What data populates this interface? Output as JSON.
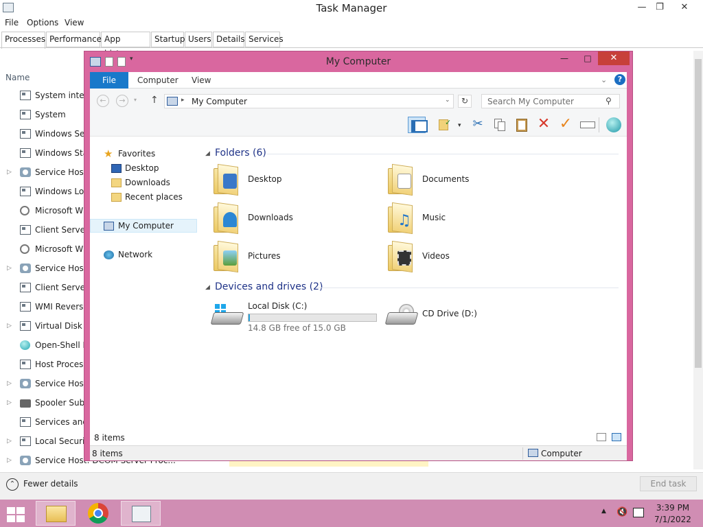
{
  "task_manager": {
    "title": "Task Manager",
    "menu": [
      "File",
      "Options",
      "View"
    ],
    "tabs": [
      "Processes",
      "Performance",
      "App history",
      "Startup",
      "Users",
      "Details",
      "Services"
    ],
    "active_tab": "Processes",
    "column_name": "Name",
    "processes": [
      {
        "name": "System interrupts",
        "icon": "window-icon",
        "expandable": false
      },
      {
        "name": "System",
        "icon": "window-icon",
        "expandable": false
      },
      {
        "name": "Windows Session Manager",
        "icon": "window-icon",
        "expandable": false
      },
      {
        "name": "Windows Start-Up Application",
        "icon": "window-icon",
        "expandable": false
      },
      {
        "name": "Service Host: Local System",
        "icon": "gear-icon",
        "expandable": true
      },
      {
        "name": "Windows Logon Application",
        "icon": "window-icon",
        "expandable": false
      },
      {
        "name": "Microsoft Windows Search",
        "icon": "user-icon",
        "expandable": false
      },
      {
        "name": "Client Server Runtime Process",
        "icon": "window-icon",
        "expandable": false
      },
      {
        "name": "Microsoft Windows Search",
        "icon": "user-icon",
        "expandable": false
      },
      {
        "name": "Service Host: Local Service",
        "icon": "gear-icon",
        "expandable": true
      },
      {
        "name": "Client Server Runtime Process",
        "icon": "window-icon",
        "expandable": false
      },
      {
        "name": "WMI Reverse Adapter",
        "icon": "window-icon",
        "expandable": false
      },
      {
        "name": "Virtual Disk Service",
        "icon": "window-icon",
        "expandable": true
      },
      {
        "name": "Open-Shell Menu",
        "icon": "shell-icon",
        "expandable": false
      },
      {
        "name": "Host Process for Windows",
        "icon": "window-icon",
        "expandable": false
      },
      {
        "name": "Service Host: Network Service",
        "icon": "gear-icon",
        "expandable": true
      },
      {
        "name": "Spooler SubSystem App",
        "icon": "printer-icon",
        "expandable": true
      },
      {
        "name": "Services and Controller app",
        "icon": "window-icon",
        "expandable": false
      },
      {
        "name": "Local Security Authority",
        "icon": "window-icon",
        "expandable": true
      },
      {
        "name": "Service Host: DCOM Server Proc...",
        "icon": "gear-icon",
        "expandable": true
      }
    ],
    "fewer_details": "Fewer details",
    "end_task": "End task"
  },
  "explorer": {
    "title": "My Computer",
    "ribbon_tabs": {
      "file": "File",
      "computer": "Computer",
      "view": "View"
    },
    "address": "My Computer",
    "search_placeholder": "Search My Computer",
    "nav": {
      "favorites": "Favorites",
      "desktop": "Desktop",
      "downloads": "Downloads",
      "recent": "Recent places",
      "my_computer": "My Computer",
      "network": "Network"
    },
    "folders_header": "Folders (6)",
    "folders": [
      {
        "name": "Desktop",
        "badge": "desktop"
      },
      {
        "name": "Documents",
        "badge": "documents"
      },
      {
        "name": "Downloads",
        "badge": "downloads"
      },
      {
        "name": "Music",
        "badge": "music"
      },
      {
        "name": "Pictures",
        "badge": "pictures"
      },
      {
        "name": "Videos",
        "badge": "videos"
      }
    ],
    "drives_header": "Devices and drives (2)",
    "drives": [
      {
        "name": "Local Disk (C:)",
        "free_text": "14.8 GB free of 15.0 GB",
        "used_fraction": 0.013
      },
      {
        "name": "CD Drive (D:)"
      }
    ],
    "item_count": "8 items",
    "status_count": "8 items",
    "status_location": "Computer"
  },
  "taskbar": {
    "time": "3:39 PM",
    "date": "7/1/2022"
  },
  "colors": {
    "explorer_frame": "#d9679f",
    "taskbar": "#d08db3",
    "file_tab": "#1979ca",
    "group_header": "#1e3287",
    "drive_bar": "#26a0da"
  }
}
